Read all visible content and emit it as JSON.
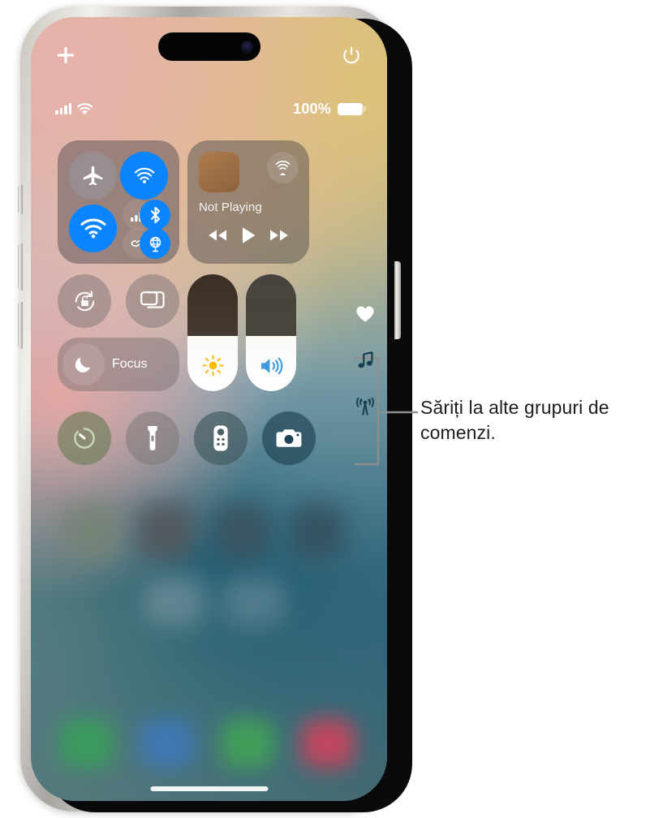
{
  "device": {
    "name": "iphone-control-center",
    "status_bar": {
      "signal_icon": "cellular-signal-icon",
      "wifi_icon": "wifi-icon",
      "battery_percent": "100%",
      "battery_icon": "battery-full-icon"
    },
    "top_actions": {
      "add_control_icon": "plus-icon",
      "power_icon": "power-icon"
    },
    "home_indicator": "home-indicator"
  },
  "control_center": {
    "connectivity": {
      "label": "connectivity-module",
      "toggles": [
        {
          "name": "airplane-mode",
          "icon": "airplane-icon",
          "state": "off",
          "color": "#96a0aa"
        },
        {
          "name": "airdrop",
          "icon": "airdrop-icon",
          "state": "on",
          "color": "#0a84ff"
        },
        {
          "name": "wifi",
          "icon": "wifi-icon",
          "state": "on",
          "color": "#0a84ff"
        },
        {
          "name": "cellular-data",
          "icon": "cellular-bars-icon",
          "state": "off",
          "color": "#a89691"
        },
        {
          "name": "bluetooth",
          "icon": "bluetooth-icon",
          "state": "on",
          "color": "#0a84ff"
        },
        {
          "name": "personal-hotspot",
          "icon": "hotspot-link-icon",
          "state": "off",
          "color": "#a89691"
        },
        {
          "name": "satellite-vpn",
          "icon": "globe-satellite-icon",
          "state": "on",
          "color": "#0a84ff"
        }
      ]
    },
    "media": {
      "label": "media-playback-module",
      "title": "Not Playing",
      "album_art": "album-artwork-placeholder",
      "airplay_icon": "airplay-audio-icon",
      "controls": [
        {
          "name": "rewind-button",
          "icon": "rewind-icon"
        },
        {
          "name": "play-button",
          "icon": "play-icon"
        },
        {
          "name": "fast-forward-button",
          "icon": "fast-forward-icon"
        }
      ]
    },
    "rotation_lock": {
      "name": "rotation-lock-toggle",
      "icon": "rotation-lock-icon",
      "state": "off"
    },
    "screen_mirroring": {
      "name": "screen-mirroring-button",
      "icon": "screen-mirroring-icon"
    },
    "focus": {
      "name": "focus-button",
      "label": "Focus",
      "icon": "moon-icon"
    },
    "sliders": [
      {
        "name": "brightness-slider",
        "icon": "brightness-sun-icon",
        "value": 47,
        "icon_color": "#ffb900"
      },
      {
        "name": "volume-slider",
        "icon": "volume-speaker-icon",
        "value": 47,
        "icon_color": "#3d9be0"
      }
    ],
    "quick_buttons": [
      {
        "name": "timer-button",
        "icon": "timer-icon"
      },
      {
        "name": "flashlight-button",
        "icon": "flashlight-icon"
      },
      {
        "name": "apple-tv-remote-button",
        "icon": "tv-remote-icon"
      },
      {
        "name": "camera-button",
        "icon": "camera-icon"
      }
    ],
    "page_rail": {
      "label": "control-group-page-rail",
      "items": [
        {
          "name": "rail-home-group",
          "icon": "heart-icon"
        },
        {
          "name": "rail-media-group",
          "icon": "music-note-icon"
        },
        {
          "name": "rail-connectivity-group",
          "icon": "connectivity-waves-icon"
        }
      ]
    }
  },
  "annotation": {
    "callout_text": "Săriți la alte grupuri de comenzi."
  }
}
